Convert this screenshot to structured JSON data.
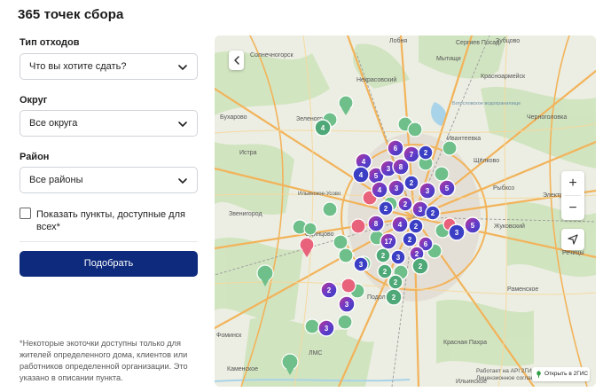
{
  "page": {
    "title": "365 точек сбора"
  },
  "filters": {
    "waste_type": {
      "label": "Тип отходов",
      "placeholder": "Что вы хотите сдать?"
    },
    "district": {
      "label": "Округ",
      "value": "Все округа"
    },
    "area": {
      "label": "Район",
      "value": "Все районы"
    },
    "public_only": {
      "label": "Показать пункты, доступные для всех*",
      "checked": false
    },
    "submit_label": "Подобрать"
  },
  "footnote": "*Некоторые экоточки доступны только для жителей определенного дома, клиентов или работников определенной организации. Это указано в описании пункта.",
  "map": {
    "attribution_line1": "Работает на API 2ГИС",
    "attribution_line2": "Лицензионное соглашение",
    "open_2gis_label": "Открыть в 2ГИС",
    "zoom_in_label": "+",
    "zoom_out_label": "−",
    "colors": {
      "pin_green": "#6fbf8a",
      "pin_pink": "#e8627b",
      "cluster_blue": "#3b3fc4",
      "cluster_purple": "#8a3ab9",
      "cluster_green": "#4fa877"
    },
    "place_names": [
      "Солнечногорск",
      "Лобня",
      "Мытищи",
      "Некрасовский",
      "Сергиев Посад",
      "Зубцово",
      "Красноармейск",
      "Бухарово",
      "Зеленоград",
      "Богословское водохранилище",
      "Черноголовка",
      "Истра",
      "Ивантеевка",
      "Щёлково",
      "Ильинское-Усово",
      "Рыбхоз",
      "Электроугли",
      "Звенигород",
      "Одинцово",
      "Жуковский",
      "Речицы",
      "Раменское",
      "Подольск",
      "Фоминск",
      "ЛМС",
      "Каменское",
      "Красная Пахра",
      "Ильинское"
    ],
    "clusters": [
      "4",
      "4",
      "6",
      "5",
      "4",
      "3",
      "8",
      "7",
      "2",
      "4",
      "3",
      "2",
      "3",
      "5",
      "2",
      "2",
      "3",
      "2",
      "4",
      "5",
      "2",
      "8",
      "3",
      "17",
      "2",
      "6",
      "2",
      "3",
      "2",
      "2",
      "2",
      "2",
      "3",
      "2",
      "3",
      "2",
      "3"
    ]
  }
}
